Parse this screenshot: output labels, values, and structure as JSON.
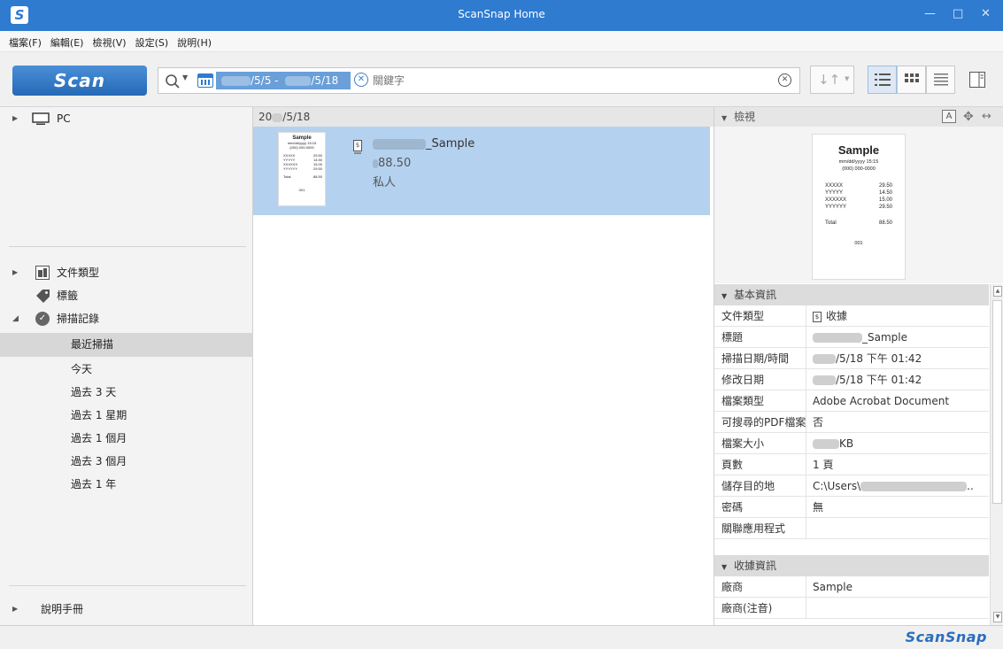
{
  "window": {
    "title": "ScanSnap Home",
    "minimize": "—",
    "maximize": "□",
    "close": "✕"
  },
  "menu": [
    "檔案(F)",
    "編輯(E)",
    "檢視(V)",
    "設定(S)",
    "說明(H)"
  ],
  "toolbar": {
    "scan_label": "Scan",
    "date_from": "/5/5 -",
    "date_to": "/5/18",
    "keyword_placeholder": "關鍵字"
  },
  "left_panel": {
    "pc_label": "PC",
    "doc_type_label": "文件類型",
    "tags_label": "標籤",
    "history_label": "掃描記錄",
    "history_items": [
      "最近掃描",
      "今天",
      "過去 3 天",
      "過去 1 星期",
      "過去 1 個月",
      "過去 3 個月",
      "過去 1 年"
    ],
    "help_label": "說明手冊"
  },
  "center": {
    "date_header_prefix": "20",
    "date_header_suffix": "/5/18",
    "item": {
      "title_suffix": "_Sample",
      "amount": "88.50",
      "category": "私人"
    }
  },
  "preview": {
    "header": "檢視",
    "receipt": {
      "title": "Sample",
      "date_line": "mm/dd/yyyy 15:15",
      "phone": "(000) 000-0000",
      "lines": [
        {
          "name": "XXXXX",
          "price": "29.50"
        },
        {
          "name": "YYYYY",
          "price": "14.50"
        },
        {
          "name": "XXXXXX",
          "price": "15.00"
        },
        {
          "name": "YYYYYY",
          "price": "29.50"
        }
      ],
      "total_label": "Total",
      "total": "88.50",
      "footer": "001"
    }
  },
  "basic_info": {
    "header": "基本資訊",
    "rows": [
      {
        "key": "文件類型",
        "value": "收據"
      },
      {
        "key": "標題",
        "value": "_Sample"
      },
      {
        "key": "掃描日期/時間",
        "value": "/5/18 下午 01:42"
      },
      {
        "key": "修改日期",
        "value": "/5/18 下午 01:42"
      },
      {
        "key": "檔案類型",
        "value": "Adobe Acrobat Document"
      },
      {
        "key": "可搜尋的PDF檔案",
        "value": "否"
      },
      {
        "key": "檔案大小",
        "value": "KB"
      },
      {
        "key": "頁數",
        "value": "1 頁"
      },
      {
        "key": "儲存目的地",
        "value": "C:\\Users\\"
      },
      {
        "key": "密碼",
        "value": "無"
      },
      {
        "key": "關聯應用程式",
        "value": ""
      }
    ]
  },
  "receipt_info": {
    "header": "收據資訊",
    "rows": [
      {
        "key": "廠商",
        "value": "Sample"
      },
      {
        "key": "廠商(注音)",
        "value": ""
      }
    ]
  },
  "status_bar": {
    "brand": "ScanSnap"
  },
  "colors": {
    "accent": "#2e7bd0",
    "selection": "#b4d2ef",
    "brand": "#2a6ec0"
  }
}
